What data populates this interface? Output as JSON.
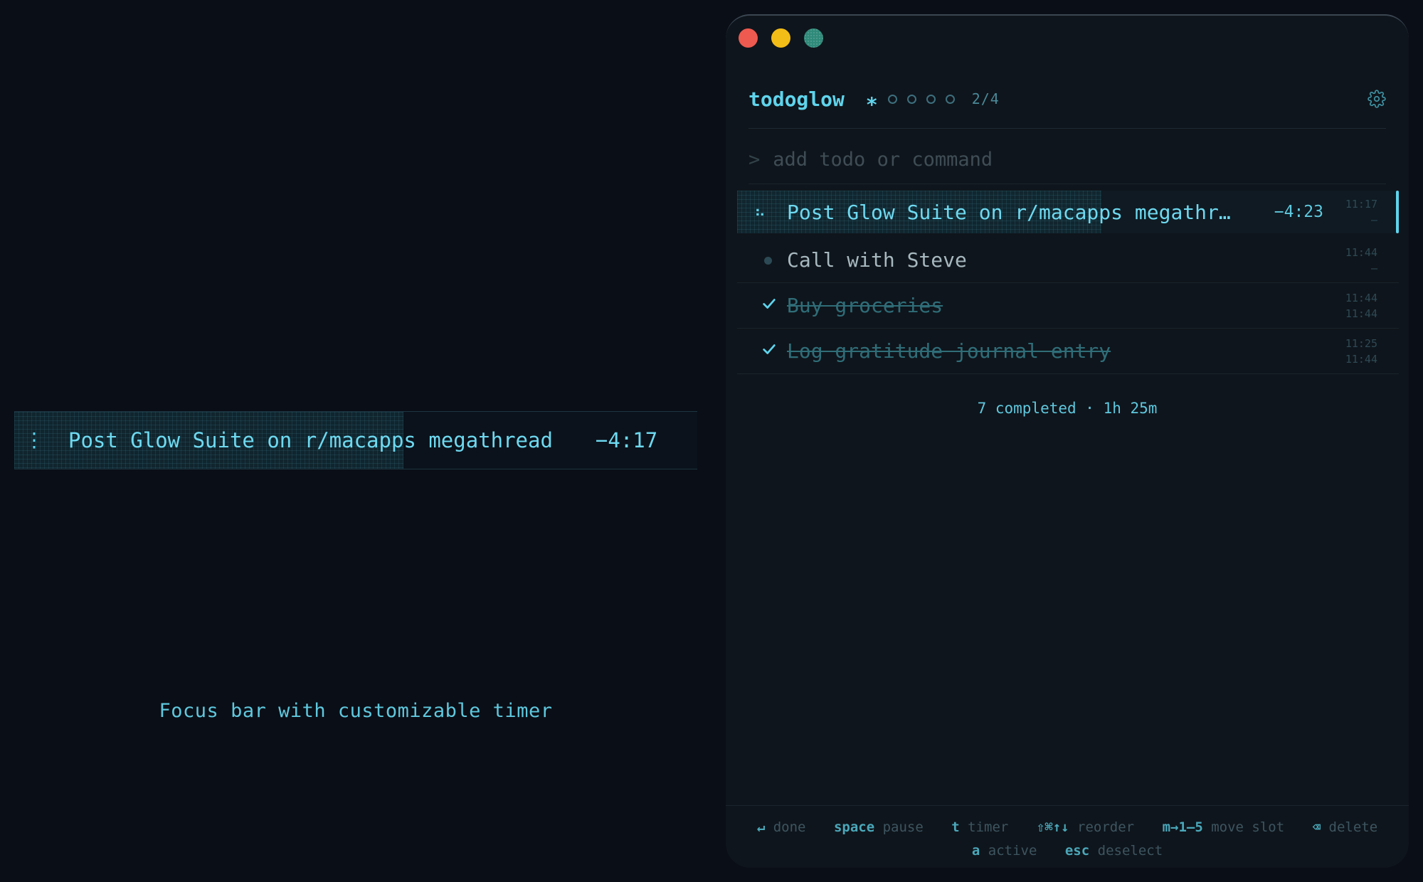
{
  "focus_bar": {
    "handle_glyph": "⋮",
    "title": "Post Glow Suite on r/macapps megathread",
    "timer": "−4:17",
    "progress": 0.57
  },
  "caption": "Focus bar with customizable timer",
  "window": {
    "app_title": "todoglow",
    "active_slot_glyph": "∗",
    "slot_count": "2/4",
    "input": {
      "prompt": ">",
      "placeholder": "add todo or command",
      "value": ""
    },
    "todos": [
      {
        "label": "Post Glow Suite on r/macapps megathr…",
        "marker": "⠦",
        "state": "active",
        "countdown": "−4:23",
        "time_start": "11:17",
        "time_end": "–",
        "progress": 0.55
      },
      {
        "label": "Call with Steve",
        "state": "pending",
        "time_start": "11:44",
        "time_end": "–"
      },
      {
        "label": "Buy groceries",
        "state": "done",
        "time_start": "11:44",
        "time_end": "11:44"
      },
      {
        "label": "Log gratitude journal entry",
        "state": "done",
        "time_start": "11:25",
        "time_end": "11:44"
      }
    ],
    "summary": "7 completed · 1h 25m",
    "shortcuts_row1": [
      {
        "key": "↵",
        "action": "done"
      },
      {
        "key": "space",
        "action": "pause"
      },
      {
        "key": "t",
        "action": "timer"
      },
      {
        "key": "⇧⌘↑↓",
        "action": "reorder"
      },
      {
        "key": "m→1–5",
        "action": "move slot"
      },
      {
        "key": "⌫",
        "action": "delete"
      }
    ],
    "shortcuts_row2": [
      {
        "key": "a",
        "action": "active"
      },
      {
        "key": "esc",
        "action": "deselect"
      }
    ]
  },
  "colors": {
    "accent": "#5fd4ec",
    "background": "#0a0e16",
    "window": "#0f151c",
    "close": "#ee5a4f",
    "minimize": "#f3bd17",
    "maximize": "#2f8a7a"
  },
  "icons": [
    "gear-icon",
    "check-icon",
    "drag-handle-icon"
  ]
}
